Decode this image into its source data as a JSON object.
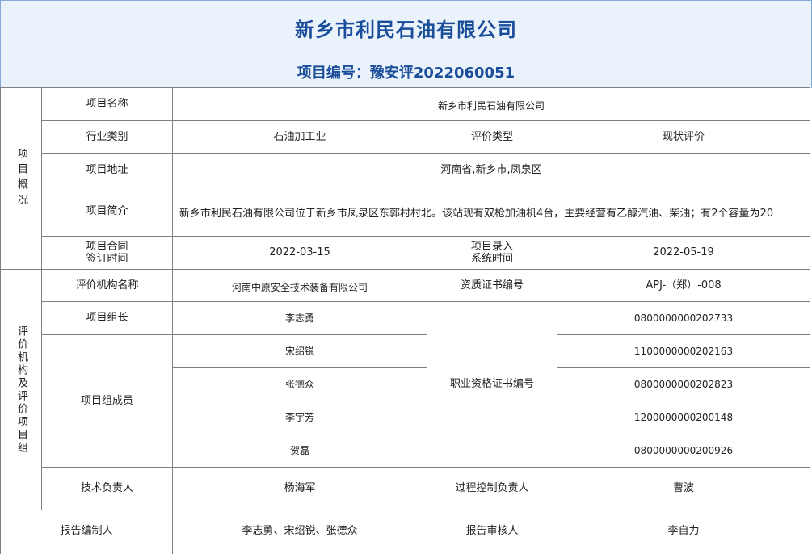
{
  "header": {
    "company_title": "新乡市利民石油有限公司",
    "project_number_label": "项目编号：",
    "project_number_value": "豫安评2022060051"
  },
  "overview": {
    "section_label": "项目概况",
    "project_name_label": "项目名称",
    "project_name_value": "新乡市利民石油有限公司",
    "industry_label": "行业类别",
    "industry_value": "石油加工业",
    "eval_type_label": "评价类型",
    "eval_type_value": "现状评价",
    "address_label": "项目地址",
    "address_value": "河南省,新乡市,凤泉区",
    "intro_label": "项目简介",
    "intro_value": "新乡市利民石油有限公司位于新乡市凤泉区东郭村村北。该站现有双枪加油机4台，主要经营有乙醇汽油、柴油；有2个容量为20",
    "contract_date_label_1": "项目合同",
    "contract_date_label_2": "签订时间",
    "contract_date_value": "2022-03-15",
    "entry_date_label_1": "项目录入",
    "entry_date_label_2": "系统时间",
    "entry_date_value": "2022-05-19"
  },
  "org": {
    "section_label": "评价机构及评价项目组",
    "org_name_label": "评价机构名称",
    "org_name_value": "河南中原安全技术装备有限公司",
    "cert_label": "资质证书编号",
    "cert_value": "APJ-（郑）-008",
    "leader_label": "项目组长",
    "leader_name": "李志勇",
    "leader_cert": "0800000000202733",
    "members_label": "项目组成员",
    "qualification_label": "职业资格证书编号",
    "members": [
      {
        "name": "宋绍锐",
        "cert": "1100000000202163"
      },
      {
        "name": "张德众",
        "cert": "0800000000202823"
      },
      {
        "name": "李宇芳",
        "cert": "1200000000200148"
      },
      {
        "name": "贺磊",
        "cert": "0800000000200926"
      }
    ],
    "tech_lead_label": "技术负责人",
    "tech_lead_value": "杨海军",
    "process_lead_label": "过程控制负责人",
    "process_lead_value": "曹波"
  },
  "report": {
    "author_label": "报告编制人",
    "author_value": "李志勇、宋绍锐、张德众",
    "reviewer_label": "报告审核人",
    "reviewer_value": "李自力"
  }
}
